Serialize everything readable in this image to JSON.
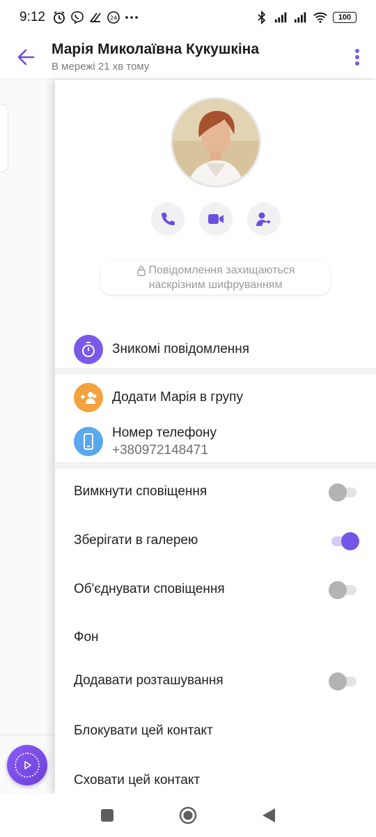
{
  "status": {
    "time": "9:12",
    "battery": "100",
    "left_icons": [
      "alarm-icon",
      "viber-icon",
      "fastforward-icon",
      "24-badge-icon",
      "more-dots-icon"
    ],
    "right_icons": [
      "bluetooth-icon",
      "signal-icon",
      "signal-icon",
      "wifi-icon",
      "battery-icon"
    ]
  },
  "header": {
    "title": "Марія Миколаївна Кукушкіна",
    "subtitle": "В мережі 21 хв тому"
  },
  "e2e": {
    "line1": "Повідомлення захищаються",
    "line2": "наскрізним шифруванням"
  },
  "items": {
    "disappearing": "Зникомі повідомлення",
    "add_to_group": "Додати Марія в групу",
    "phone_label": "Номер телефону",
    "phone_number": "+380972148471"
  },
  "settings": [
    {
      "label": "Вимкнути сповіщення",
      "toggle": false
    },
    {
      "label": "Зберігати в галерею",
      "toggle": true
    },
    {
      "label": "Об'єднувати сповіщення",
      "toggle": false
    },
    {
      "label": "Фон"
    },
    {
      "label": "Додавати розташування",
      "toggle": false
    },
    {
      "label": "Блокувати цей контакт"
    },
    {
      "label": "Сховати цей контакт"
    }
  ],
  "colors": {
    "accent": "#7456e6",
    "disappearing_icon": "#7a5ae8",
    "group_icon": "#f3a23d",
    "phone_icon": "#5aa8ee"
  }
}
